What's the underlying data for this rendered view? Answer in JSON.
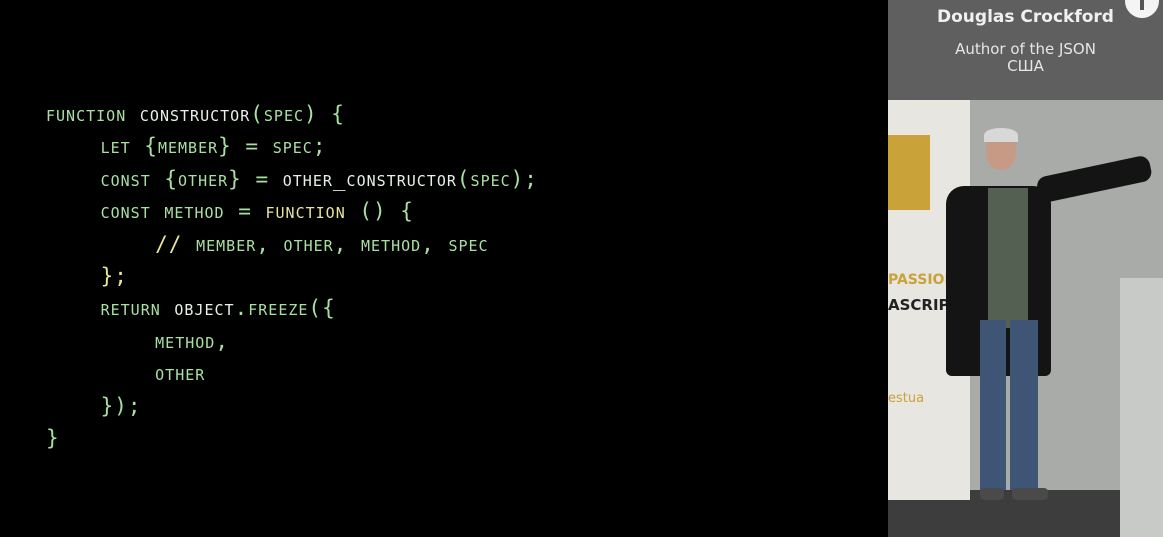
{
  "slide": {
    "code_lines": [
      [
        {
          "t": "function ",
          "c": "kw"
        },
        {
          "t": "constructor",
          "c": "id"
        },
        {
          "t": "(spec) {",
          "c": "kw"
        }
      ],
      [
        {
          "t": "    let {member} = spec;",
          "c": "kw"
        }
      ],
      [
        {
          "t": "    const {other} = ",
          "c": "kw"
        },
        {
          "t": "other_constructor",
          "c": "id"
        },
        {
          "t": "(spec);",
          "c": "kw"
        }
      ],
      [
        {
          "t": "    const method = ",
          "c": "kw"
        },
        {
          "t": "function",
          "c": "fn"
        },
        {
          "t": " () {",
          "c": "kw"
        }
      ],
      [
        {
          "t": "        //",
          "c": "cm"
        },
        {
          "t": " member, other, method, spec",
          "c": "kw"
        }
      ],
      [
        {
          "t": "    };",
          "c": "fn"
        }
      ],
      [
        {
          "t": "    return ",
          "c": "kw"
        },
        {
          "t": "Object",
          "c": "id"
        },
        {
          "t": ".freeze({",
          "c": "kw"
        }
      ],
      [
        {
          "t": "        method,",
          "c": "kw"
        }
      ],
      [
        {
          "t": "        other",
          "c": "kw"
        }
      ],
      [
        {
          "t": "    });",
          "c": "kw"
        }
      ],
      [
        {
          "t": "}",
          "c": "kw"
        }
      ]
    ]
  },
  "speaker": {
    "name": "Douglas Crockford",
    "title_line1": "Author of the JSON",
    "title_line2": "США"
  },
  "banner": {
    "text1": "PASSION",
    "text2": "ASCRIPT",
    "text3": "estua"
  },
  "icons": {
    "info": "info-icon"
  }
}
